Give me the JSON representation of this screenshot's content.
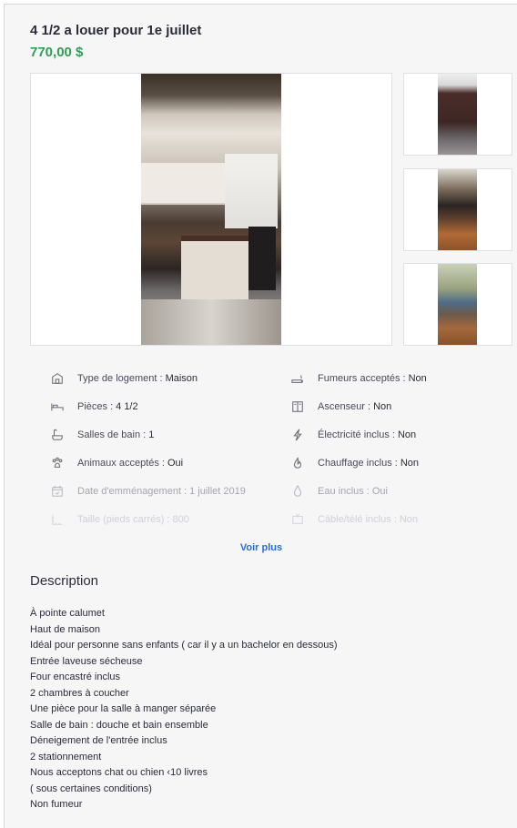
{
  "listing": {
    "title": "4 1/2 a louer pour 1e juillet",
    "price": "770,00 $"
  },
  "photos": {
    "main": "kitchen-photo",
    "thumbnails": [
      "bedroom-photo",
      "living-room-photo",
      "room-photo"
    ]
  },
  "features_left": [
    {
      "icon": "house-icon",
      "label": "Type de logement :",
      "value": "Maison"
    },
    {
      "icon": "bed-icon",
      "label": "Pièces :",
      "value": "4 1/2"
    },
    {
      "icon": "bath-icon",
      "label": "Salles de bain :",
      "value": "1"
    },
    {
      "icon": "paw-icon",
      "label": "Animaux acceptés :",
      "value": "Oui"
    },
    {
      "icon": "calendar-icon",
      "label": "Date d'emménagement :",
      "value": "1 juillet 2019"
    },
    {
      "icon": "ruler-icon",
      "label": "Taille (pieds carrés) :",
      "value": "800"
    }
  ],
  "features_right": [
    {
      "icon": "cigarette-icon",
      "label": "Fumeurs acceptés :",
      "value": "Non"
    },
    {
      "icon": "elevator-icon",
      "label": "Ascenseur :",
      "value": "Non"
    },
    {
      "icon": "lightning-icon",
      "label": "Électricité inclus :",
      "value": "Non"
    },
    {
      "icon": "flame-icon",
      "label": "Chauffage inclus :",
      "value": "Non"
    },
    {
      "icon": "drop-icon",
      "label": "Eau inclus :",
      "value": "Oui"
    },
    {
      "icon": "tv-icon",
      "label": "Câble/télé inclus :",
      "value": "Non"
    }
  ],
  "see_more": "Voir plus",
  "description": {
    "heading": "Description",
    "lines": [
      "À pointe calumet",
      "Haut de maison",
      "Idéal pour personne sans enfants ( car il y a un bachelor en dessous)",
      "Entrée laveuse sécheuse",
      "Four encastré inclus",
      "2 chambres à coucher",
      "Une pièce pour la salle à manger séparée",
      "Salle de bain : douche et bain ensemble",
      "Déneigement de l'entrée inclus",
      "2 stationnement",
      "Nous acceptons chat ou chien ‹10 livres",
      "( sous certaines conditions)",
      "Non fumeur"
    ]
  }
}
